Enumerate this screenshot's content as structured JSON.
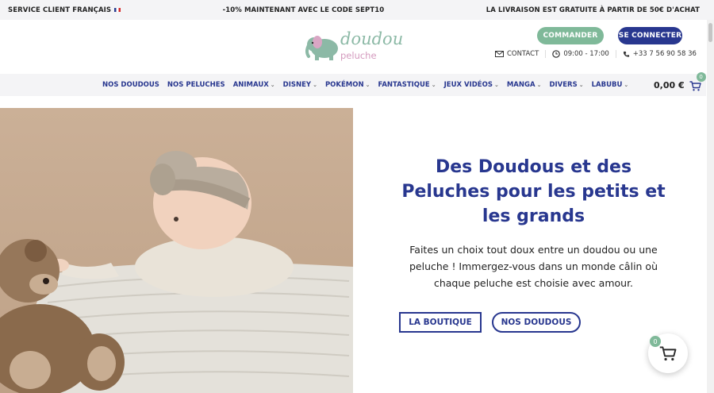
{
  "topbar": {
    "service": "SERVICE CLIENT FRANÇAIS",
    "promo": "-10% MAINTENANT AVEC LE CODE SEPT10",
    "shipping": "LA LIVRAISON EST GRATUITE À PARTIR DE 50€ D'ACHAT"
  },
  "header": {
    "logo_top": "doudou",
    "logo_bottom": "peluche",
    "order_label": "COMMANDER",
    "login_label": "SE CONNECTER",
    "contact_label": "CONTACT",
    "hours": "09:00 - 17:00",
    "phone": "+33 7 56 90 58 36"
  },
  "nav": {
    "items": [
      {
        "label": "NOS DOUDOUS"
      },
      {
        "label": "NOS PELUCHES"
      },
      {
        "label": "ANIMAUX"
      },
      {
        "label": "DISNEY"
      },
      {
        "label": "POKÉMON"
      },
      {
        "label": "FANTASTIQUE"
      },
      {
        "label": "JEUX VIDÉOS"
      },
      {
        "label": "MANGA"
      },
      {
        "label": "DIVERS"
      },
      {
        "label": "LABUBU"
      }
    ],
    "cart_total": "0,00 €",
    "cart_count": "0"
  },
  "hero": {
    "title": "Des Doudous et des Peluches pour les petits et les grands",
    "subtitle": "Faites un choix tout doux entre un doudou ou une peluche ! Immergez-vous dans un monde câlin où chaque peluche est choisie avec amour.",
    "button_shop": "LA BOUTIQUE",
    "button_doudous": "NOS DOUDOUS"
  },
  "floating_cart": {
    "count": "0"
  },
  "icons": {
    "mail": "mail-icon",
    "clock": "clock-icon",
    "phone": "phone-icon",
    "cart": "cart-icon",
    "chevron": "chevron-down-icon"
  },
  "colors": {
    "brand_blue": "#28378f",
    "brand_green": "#7fb999",
    "logo_pink": "#d49abe"
  }
}
